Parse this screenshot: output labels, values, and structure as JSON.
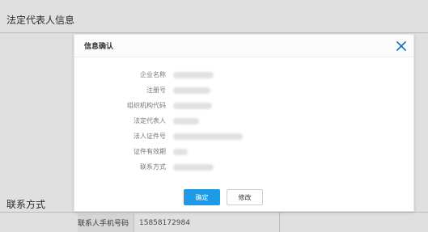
{
  "background": {
    "legal_rep_title": "法定代表人信息",
    "contact_title": "联系方式",
    "contact_row": {
      "label": "联系人手机号码",
      "value": "15858172984"
    }
  },
  "dialog": {
    "title": "信息确认",
    "close_icon": "close-icon",
    "fields": [
      {
        "label": "企业名称"
      },
      {
        "label": "注册号"
      },
      {
        "label": "组织机构代码"
      },
      {
        "label": "法定代表人"
      },
      {
        "label": "法人证件号"
      },
      {
        "label": "证件有效期"
      },
      {
        "label": "联系方式"
      }
    ],
    "confirm_label": "确定",
    "modify_label": "修改"
  },
  "colors": {
    "accent": "#1e9be6",
    "close_icon": "#1e73be"
  }
}
